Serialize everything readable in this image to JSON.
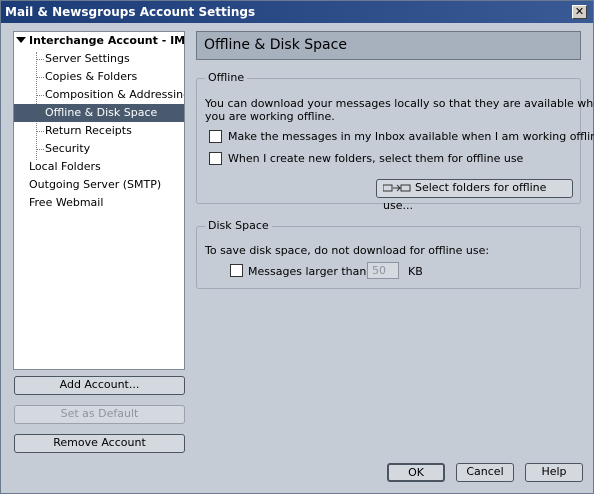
{
  "window": {
    "title": "Mail & Newsgroups Account Settings",
    "close_glyph": "✕"
  },
  "tree": {
    "root": "Interchange Account - IM...",
    "children": [
      "Server Settings",
      "Copies & Folders",
      "Composition & Addressing",
      "Offline & Disk Space",
      "Return Receipts",
      "Security"
    ],
    "others": [
      "Local Folders",
      "Outgoing Server (SMTP)",
      "Free Webmail"
    ],
    "selected": "Offline & Disk Space"
  },
  "left_buttons": {
    "add_account": "Add Account...",
    "set_default": "Set as Default",
    "remove_account": "Remove Account"
  },
  "panel": {
    "title": "Offline & Disk Space",
    "offline": {
      "legend": "Offline",
      "description_line1": "You can download your messages locally so that they are available when",
      "description_line2": "you are working offline.",
      "checkbox1": "Make the messages in my Inbox available when I am working offline",
      "checkbox2": "When I create new folders, select them for offline use",
      "select_folders_button": "Select folders for offline use..."
    },
    "disk_space": {
      "legend": "Disk Space",
      "description": "To save disk space, do not download for offline use:",
      "messages_larger_than": "Messages larger than",
      "size_value": "50",
      "size_unit": "KB"
    }
  },
  "dialog_buttons": {
    "ok": "OK",
    "cancel": "Cancel",
    "help": "Help"
  }
}
